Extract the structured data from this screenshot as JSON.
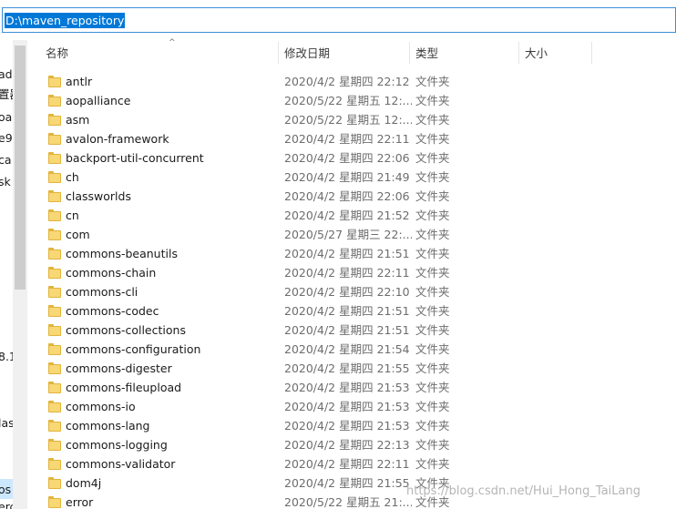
{
  "address": {
    "path": "D:\\maven_repository"
  },
  "nav": {
    "items": [
      {
        "text": "ad"
      },
      {
        "text": "置器"
      },
      {
        "text": "oa"
      },
      {
        "text": "e9"
      },
      {
        "text": "ca"
      },
      {
        "text": "sk"
      },
      {
        "text": "8.1"
      },
      {
        "text": "las"
      },
      {
        "text": "os"
      },
      {
        "text": "erc"
      }
    ]
  },
  "columns": {
    "name": "名称",
    "date": "修改日期",
    "type": "类型",
    "size": "大小",
    "sort_indicator": "^"
  },
  "files": [
    {
      "name": "antlr",
      "date": "2020/4/2 星期四 22:12",
      "type": "文件夹"
    },
    {
      "name": "aopalliance",
      "date": "2020/5/22 星期五 12:...",
      "type": "文件夹"
    },
    {
      "name": "asm",
      "date": "2020/5/22 星期五 12:...",
      "type": "文件夹"
    },
    {
      "name": "avalon-framework",
      "date": "2020/4/2 星期四 22:11",
      "type": "文件夹"
    },
    {
      "name": "backport-util-concurrent",
      "date": "2020/4/2 星期四 22:06",
      "type": "文件夹"
    },
    {
      "name": "ch",
      "date": "2020/4/2 星期四 21:49",
      "type": "文件夹"
    },
    {
      "name": "classworlds",
      "date": "2020/4/2 星期四 22:06",
      "type": "文件夹"
    },
    {
      "name": "cn",
      "date": "2020/4/2 星期四 21:52",
      "type": "文件夹"
    },
    {
      "name": "com",
      "date": "2020/5/27 星期三 22:...",
      "type": "文件夹"
    },
    {
      "name": "commons-beanutils",
      "date": "2020/4/2 星期四 21:51",
      "type": "文件夹"
    },
    {
      "name": "commons-chain",
      "date": "2020/4/2 星期四 22:11",
      "type": "文件夹"
    },
    {
      "name": "commons-cli",
      "date": "2020/4/2 星期四 22:10",
      "type": "文件夹"
    },
    {
      "name": "commons-codec",
      "date": "2020/4/2 星期四 21:51",
      "type": "文件夹"
    },
    {
      "name": "commons-collections",
      "date": "2020/4/2 星期四 21:51",
      "type": "文件夹"
    },
    {
      "name": "commons-configuration",
      "date": "2020/4/2 星期四 21:54",
      "type": "文件夹"
    },
    {
      "name": "commons-digester",
      "date": "2020/4/2 星期四 21:55",
      "type": "文件夹"
    },
    {
      "name": "commons-fileupload",
      "date": "2020/4/2 星期四 21:53",
      "type": "文件夹"
    },
    {
      "name": "commons-io",
      "date": "2020/4/2 星期四 21:53",
      "type": "文件夹"
    },
    {
      "name": "commons-lang",
      "date": "2020/4/2 星期四 21:53",
      "type": "文件夹"
    },
    {
      "name": "commons-logging",
      "date": "2020/4/2 星期四 22:13",
      "type": "文件夹"
    },
    {
      "name": "commons-validator",
      "date": "2020/4/2 星期四 22:11",
      "type": "文件夹"
    },
    {
      "name": "dom4j",
      "date": "2020/4/2 星期四 21:55",
      "type": "文件夹"
    },
    {
      "name": "error",
      "date": "2020/5/22 星期五 21:...",
      "type": "文件夹"
    }
  ],
  "watermark": "https://blog.csdn.net/Hui_Hong_TaiLang",
  "colors": {
    "selection": "#0078d7",
    "folder": "#f8d775",
    "folder_edge": "#e2b43b"
  }
}
